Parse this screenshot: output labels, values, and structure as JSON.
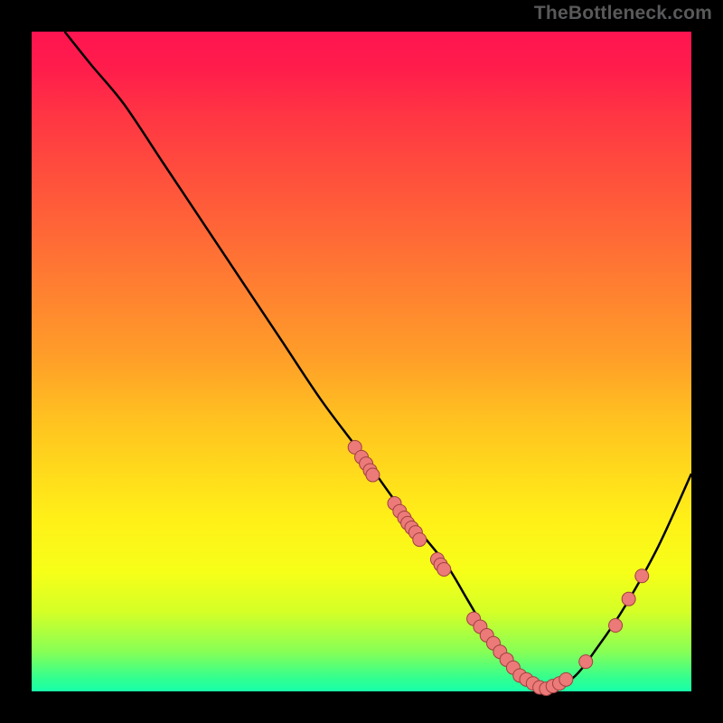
{
  "watermark": "TheBottleneck.com",
  "colors": {
    "page_bg": "#000000",
    "dot_fill": "#eb7a78",
    "dot_stroke": "#a04040",
    "curve": "#000000"
  },
  "chart_data": {
    "type": "line",
    "title": "",
    "xlabel": "",
    "ylabel": "",
    "xlim": [
      0,
      100
    ],
    "ylim": [
      0,
      100
    ],
    "grid": false,
    "legend": false,
    "series": [
      {
        "name": "curve",
        "x": [
          5,
          9,
          14,
          20,
          26,
          32,
          38,
          44,
          50,
          55,
          59,
          63,
          66,
          69,
          72,
          75,
          78,
          82,
          86,
          90,
          95,
          100
        ],
        "y": [
          100,
          95,
          89,
          80,
          71,
          62,
          53,
          44,
          36,
          29,
          24,
          19,
          14,
          9,
          5,
          2,
          0.6,
          2,
          7,
          13,
          22,
          33
        ]
      }
    ],
    "points": [
      {
        "name": "cluster-a",
        "x": 49,
        "y": 37
      },
      {
        "name": "cluster-a",
        "x": 50,
        "y": 35.5
      },
      {
        "name": "cluster-a",
        "x": 50.7,
        "y": 34.5
      },
      {
        "name": "cluster-a",
        "x": 51.3,
        "y": 33.5
      },
      {
        "name": "cluster-a",
        "x": 51.7,
        "y": 32.8
      },
      {
        "name": "cluster-b",
        "x": 55,
        "y": 28.5
      },
      {
        "name": "cluster-b",
        "x": 55.8,
        "y": 27.3
      },
      {
        "name": "cluster-b",
        "x": 56.5,
        "y": 26.3
      },
      {
        "name": "cluster-b",
        "x": 57,
        "y": 25.5
      },
      {
        "name": "cluster-b",
        "x": 57.6,
        "y": 24.8
      },
      {
        "name": "cluster-b",
        "x": 58.2,
        "y": 24.1
      },
      {
        "name": "cluster-b",
        "x": 58.8,
        "y": 23
      },
      {
        "name": "cluster-c",
        "x": 61.5,
        "y": 20
      },
      {
        "name": "cluster-c",
        "x": 62,
        "y": 19.2
      },
      {
        "name": "cluster-c",
        "x": 62.5,
        "y": 18.5
      },
      {
        "name": "bottom",
        "x": 67,
        "y": 11
      },
      {
        "name": "bottom",
        "x": 68,
        "y": 9.8
      },
      {
        "name": "bottom",
        "x": 69,
        "y": 8.5
      },
      {
        "name": "bottom",
        "x": 70,
        "y": 7.3
      },
      {
        "name": "bottom",
        "x": 71,
        "y": 6
      },
      {
        "name": "bottom",
        "x": 72,
        "y": 4.8
      },
      {
        "name": "bottom",
        "x": 73,
        "y": 3.6
      },
      {
        "name": "bottom",
        "x": 74,
        "y": 2.4
      },
      {
        "name": "bottom",
        "x": 75,
        "y": 1.8
      },
      {
        "name": "bottom",
        "x": 76,
        "y": 1.2
      },
      {
        "name": "bottom",
        "x": 77,
        "y": 0.6
      },
      {
        "name": "bottom",
        "x": 78,
        "y": 0.4
      },
      {
        "name": "bottom",
        "x": 79,
        "y": 0.8
      },
      {
        "name": "bottom",
        "x": 80,
        "y": 1.2
      },
      {
        "name": "bottom",
        "x": 81,
        "y": 1.8
      },
      {
        "name": "bottom",
        "x": 84,
        "y": 4.5
      },
      {
        "name": "right",
        "x": 88.5,
        "y": 10
      },
      {
        "name": "right",
        "x": 90.5,
        "y": 14
      },
      {
        "name": "right",
        "x": 92.5,
        "y": 17.5
      }
    ]
  }
}
